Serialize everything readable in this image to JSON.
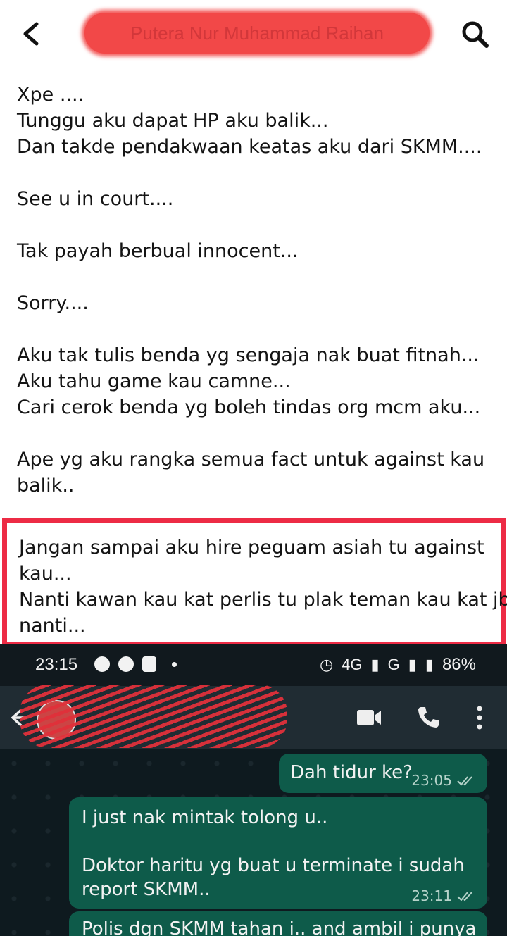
{
  "post_header": {
    "title": "Putera Nur Muhammad Raihan",
    "back_icon": "chevron-left-icon",
    "search_icon": "search-icon"
  },
  "post": {
    "paragraphs": [
      [
        "Xpe ....",
        "Tunggu aku dapat HP aku balik...",
        "Dan takde pendakwaan keatas aku dari SKMM...."
      ],
      [
        "See u in court...."
      ],
      [
        "Tak payah berbual innocent..."
      ],
      [
        "Sorry...."
      ],
      [
        "Aku tak tulis benda yg sengaja nak buat fitnah...",
        "Aku tahu game kau camne...",
        "Cari cerok benda yg boleh tindas org mcm aku..."
      ],
      [
        "Ape yg aku rangka semua fact untuk against kau",
        "balik.."
      ]
    ],
    "highlighted": [
      "Jangan sampai aku hire peguam asiah tu against",
      "kau...",
      "Nanti kawan kau kat perlis tu plak teman kau kat jb",
      "nanti..."
    ],
    "highlight_color": "#ed2b45"
  },
  "phone": {
    "status": {
      "time": "23:15",
      "network": "4G",
      "signal2": "G",
      "battery": "86%"
    },
    "chat_header": {
      "icons": [
        "back-arrow-icon",
        "video-call-icon",
        "phone-call-icon",
        "more-vert-icon"
      ]
    },
    "messages": [
      {
        "text": "Dah tidur ke?",
        "time": "23:05"
      },
      {
        "text": "I just nak mintak tolong u..\n\nDoktor haritu yg buat u terminate i sudah report SKMM..",
        "time": "23:11"
      },
      {
        "text": "Polis dgn SKMM tahan i.. and ambil i punya",
        "time": ""
      }
    ],
    "bubble_color": "#0e5b4a"
  }
}
